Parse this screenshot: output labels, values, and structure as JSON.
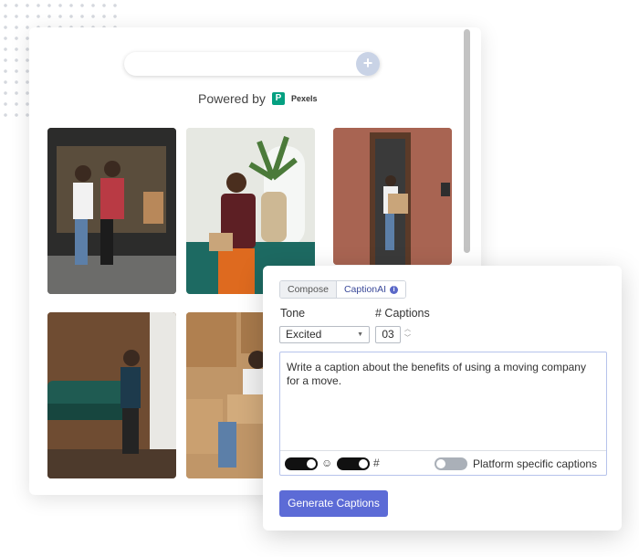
{
  "search": {
    "placeholder": "",
    "add_icon": "plus-icon"
  },
  "powered_by": {
    "text": "Powered by",
    "brand": "Pexels",
    "brand_color": "#05a081"
  },
  "photos": [
    {
      "name": "photo-couple-van"
    },
    {
      "name": "photo-man-plant"
    },
    {
      "name": "photo-woman-doorway"
    },
    {
      "name": "photo-man-couch"
    },
    {
      "name": "photo-woman-boxes"
    }
  ],
  "caption_panel": {
    "tabs": {
      "compose": "Compose",
      "captionai": "CaptionAI"
    },
    "tone_label": "Tone",
    "tone_value": "Excited",
    "captions_label": "# Captions",
    "captions_value": "03",
    "prompt_text": "Write a caption about the benefits of using a moving company for a move.",
    "emoji_icon": "☺",
    "hashtag_icon": "#",
    "platform_label": "Platform specific captions",
    "generate_label": "Generate Captions",
    "accent_color": "#5c6bd6"
  }
}
